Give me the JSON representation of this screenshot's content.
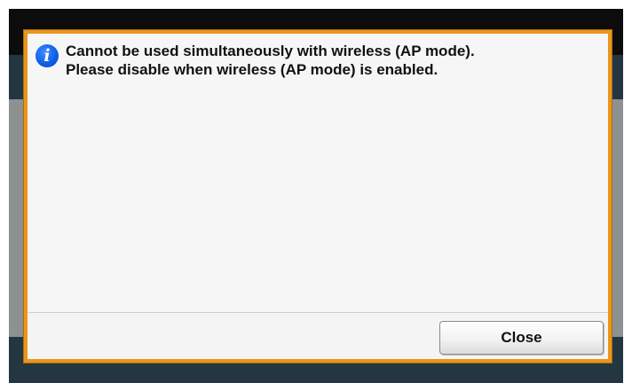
{
  "dialog": {
    "icon": "info-icon",
    "icon_glyph": "i",
    "message_lines": [
      "Cannot be used simultaneously with wireless (AP mode).",
      "Please disable when wireless (AP mode) is enabled."
    ],
    "close_label": "Close"
  },
  "colors": {
    "dialog_border": "#e8961c",
    "dialog_background": "#f6f6f6",
    "info_icon": "#1060e6",
    "screen_bands": "#233642",
    "screen_backdrop": "#8e9192"
  }
}
